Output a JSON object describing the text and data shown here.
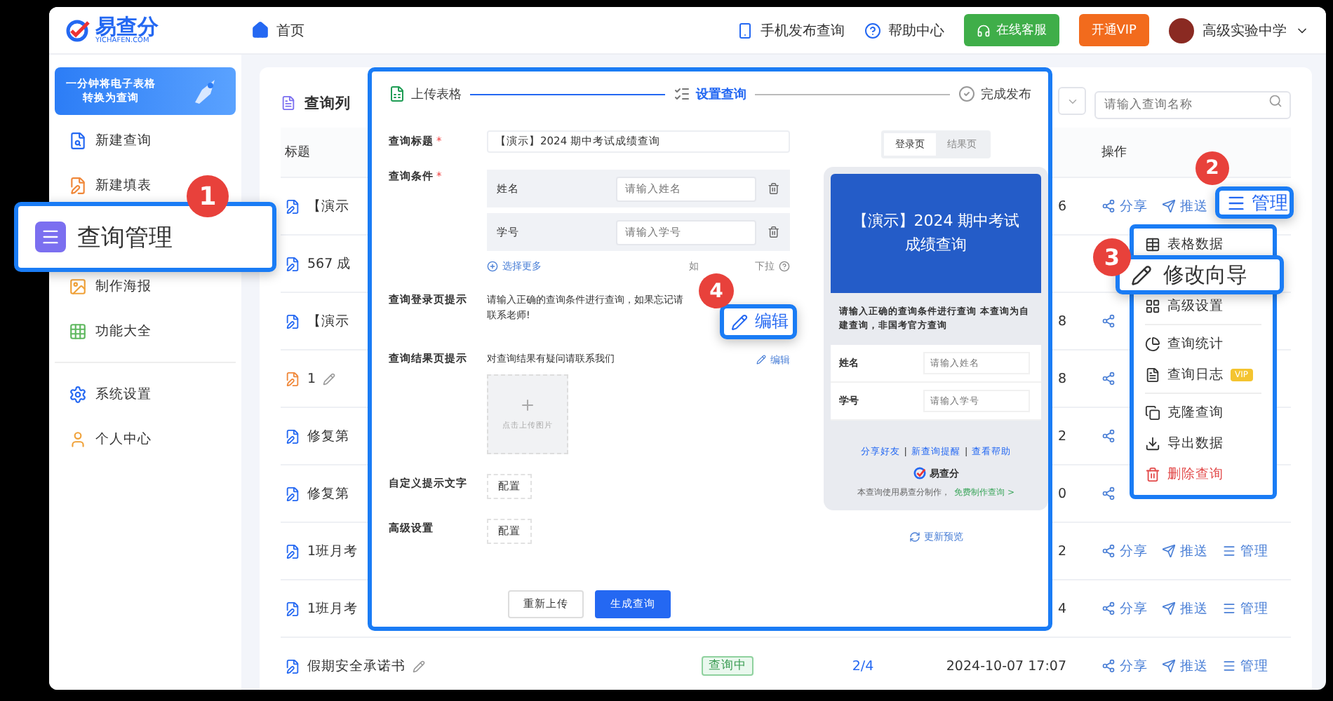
{
  "top_bar": {
    "logo": {
      "name": "易查分",
      "domain": "YICHAFEN.COM"
    },
    "nav": [
      {
        "label": "首页",
        "kind": "home"
      }
    ],
    "links": [
      {
        "label": "手机发布查询",
        "kind": "phone"
      },
      {
        "label": "帮助中心",
        "kind": "help"
      }
    ],
    "buttons": [
      {
        "label": "在线客服",
        "kind": "support"
      },
      {
        "label": "开通VIP",
        "kind": "vip"
      }
    ],
    "user": {
      "name": "高级实验中学"
    }
  },
  "sidebar": {
    "banner": {
      "lines": [
        "一分钟将电子表格",
        "转换为查询"
      ]
    },
    "groups": [
      [
        {
          "label": "新建查询",
          "kind": "query"
        },
        {
          "label": "新建填表",
          "kind": "form"
        },
        {
          "label": "制作海报",
          "kind": "poster"
        },
        {
          "label": "功能大全",
          "kind": "features"
        }
      ],
      [
        {
          "label": "系统设置",
          "kind": "settings"
        },
        {
          "label": "个人中心",
          "kind": "user"
        }
      ]
    ]
  },
  "list": {
    "title": "查询列",
    "search": {
      "placeholder": "请输入查询名称"
    },
    "columns": [
      "标题",
      "操作"
    ],
    "rows": [
      {
        "title": "【演示",
        "kind": "query",
        "editable": false,
        "tail": "6",
        "actions": [
          {
            "kind": "share",
            "label": "分享"
          },
          {
            "kind": "push",
            "label": "推送"
          }
        ]
      },
      {
        "title": "567 成",
        "kind": "query",
        "editable": false
      },
      {
        "title": "【演示",
        "kind": "query",
        "editable": false,
        "tail": "8",
        "actions": [
          {
            "kind": "share"
          }
        ]
      },
      {
        "title": "1",
        "kind": "form",
        "editable": true,
        "tail": "8",
        "actions": [
          {
            "kind": "share"
          }
        ]
      },
      {
        "title": "修复第",
        "kind": "query",
        "editable": false,
        "tail": "2",
        "actions": [
          {
            "kind": "share"
          }
        ]
      },
      {
        "title": "修复第",
        "kind": "query",
        "editable": false,
        "tail": "0",
        "actions": [
          {
            "kind": "share"
          }
        ]
      },
      {
        "title": "1班月考",
        "kind": "query",
        "editable": false,
        "tail": "2",
        "actions": [
          {
            "kind": "share",
            "label": "分享"
          },
          {
            "kind": "push",
            "label": "推送"
          },
          {
            "kind": "manage",
            "label": "管理"
          }
        ]
      },
      {
        "title": "1班月考",
        "kind": "query",
        "editable": false,
        "tail": "4",
        "actions": [
          {
            "kind": "share",
            "label": "分享"
          },
          {
            "kind": "push",
            "label": "推送"
          },
          {
            "kind": "manage",
            "label": "管理"
          }
        ]
      },
      {
        "title": "假期安全承诺书",
        "kind": "query",
        "editable": true,
        "status": "查询中",
        "progress": "2/4",
        "tail": "2024-10-07 17:07",
        "actions": [
          {
            "kind": "share",
            "label": "分享"
          },
          {
            "kind": "push",
            "label": "推送"
          },
          {
            "kind": "manage",
            "label": "管理"
          }
        ]
      }
    ]
  },
  "modal": {
    "steps": [
      {
        "label": "上传表格",
        "kind": "upload",
        "selected": false
      },
      {
        "label": "设置查询",
        "kind": "setup",
        "selected": true
      },
      {
        "label": "完成发布",
        "kind": "publish",
        "selected": false
      }
    ],
    "title_field": {
      "label": "查询标题",
      "required_mark": "*",
      "value": "【演示】2024 期中考试成绩查询"
    },
    "conditions": {
      "label": "查询条件",
      "required_mark": "*",
      "items": [
        {
          "name": "姓名",
          "placeholder": "请输入姓名"
        },
        {
          "name": "学号",
          "placeholder": "请输入学号"
        }
      ],
      "more": "选择更多",
      "hint_start": "如",
      "hint_end": "下拉"
    },
    "login_tip": {
      "label": "查询登录页提示",
      "text": "请输入正确的查询条件进行查询，如果忘记请联系老师!"
    },
    "result_tip": {
      "label": "查询结果页提示",
      "text": "对查询结果有疑问请联系我们",
      "edit": "编辑",
      "upload": "点击上传图片"
    },
    "configs": [
      {
        "label": "自定义提示文字",
        "button": "配置"
      },
      {
        "label": "高级设置",
        "button": "配置"
      }
    ],
    "footer": [
      {
        "label": "重新上传",
        "kind": "secondary"
      },
      {
        "label": "生成查询",
        "kind": "primary"
      }
    ],
    "preview": {
      "tabs": [
        {
          "label": "登录页",
          "selected": true
        },
        {
          "label": "结果页",
          "selected": false
        }
      ],
      "title": "【演示】2024 期中考试成绩查询",
      "notice": "请输入正确的查询条件进行查询 本查询为自建查询，非国考官方查询",
      "fields": [
        {
          "label": "姓名",
          "placeholder": "请输入姓名"
        },
        {
          "label": "学号",
          "placeholder": "请输入学号"
        }
      ],
      "links": [
        "分享好友",
        "新查询提醒",
        "查看帮助"
      ],
      "link_separator": "|",
      "brand": "易查分",
      "credit": "本查询使用易查分制作，",
      "credit_link": "免费制作查询 >",
      "refresh": "更新预览"
    }
  },
  "menu": {
    "groups": [
      [
        {
          "label": "表格数据",
          "kind": "table"
        },
        {
          "label": "高级设置",
          "kind": "grid"
        }
      ],
      [
        {
          "label": "查询统计",
          "kind": "stats"
        },
        {
          "label": "查询日志",
          "kind": "log",
          "badge": "VIP"
        }
      ],
      [
        {
          "label": "克隆查询",
          "kind": "clone"
        },
        {
          "label": "导出数据",
          "kind": "export"
        },
        {
          "label": "删除查询",
          "kind": "delete"
        }
      ]
    ]
  },
  "callouts": [
    {
      "number": "1",
      "label": "查询管理",
      "kind": "sidebar"
    },
    {
      "number": "2",
      "label": "管理",
      "kind": "manage"
    },
    {
      "number": "3",
      "label": "修改向导",
      "kind": "wizard"
    },
    {
      "number": "4",
      "label": "编辑",
      "kind": "edit"
    }
  ]
}
